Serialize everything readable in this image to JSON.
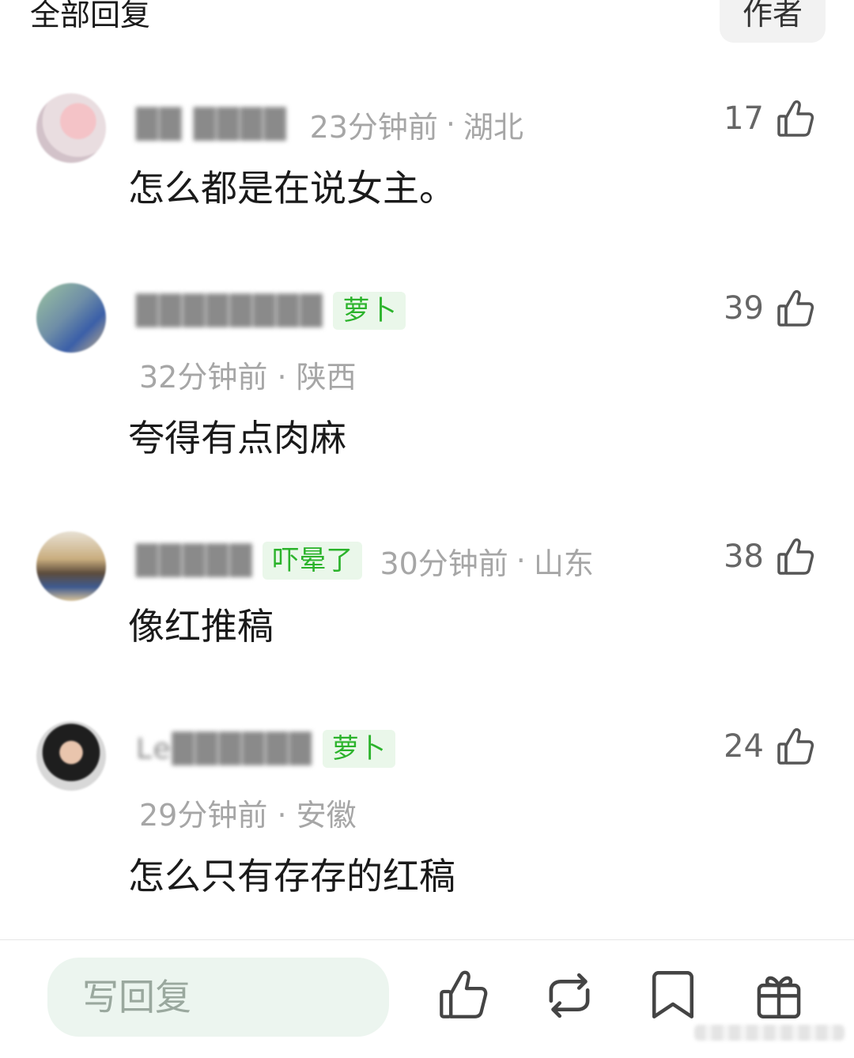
{
  "header": {
    "title": "全部回复",
    "filter_label": "作者"
  },
  "comments": [
    {
      "name": "██ ████",
      "badge": "",
      "time": "23分钟前",
      "location": "湖北",
      "text": "怎么都是在说女主。",
      "likes": "17"
    },
    {
      "name": "████████",
      "badge": "萝卜",
      "time": "32分钟前",
      "location": "陕西",
      "text": "夸得有点肉麻",
      "likes": "39"
    },
    {
      "name": "█████",
      "badge": "吓晕了",
      "time": "30分钟前",
      "location": "山东",
      "text": "像红推稿",
      "likes": "38"
    },
    {
      "name": "Le██████",
      "badge": "萝卜",
      "time": "29分钟前",
      "location": "安徽",
      "text": "怎么只有存存的红稿",
      "likes": "24"
    }
  ],
  "bottom_bar": {
    "reply_placeholder": "写回复"
  },
  "colors": {
    "badge_text": "#2bb32b",
    "badge_bg": "#eaf7ea",
    "meta": "#a6a6a6",
    "input_bg": "#ecf5ef"
  }
}
